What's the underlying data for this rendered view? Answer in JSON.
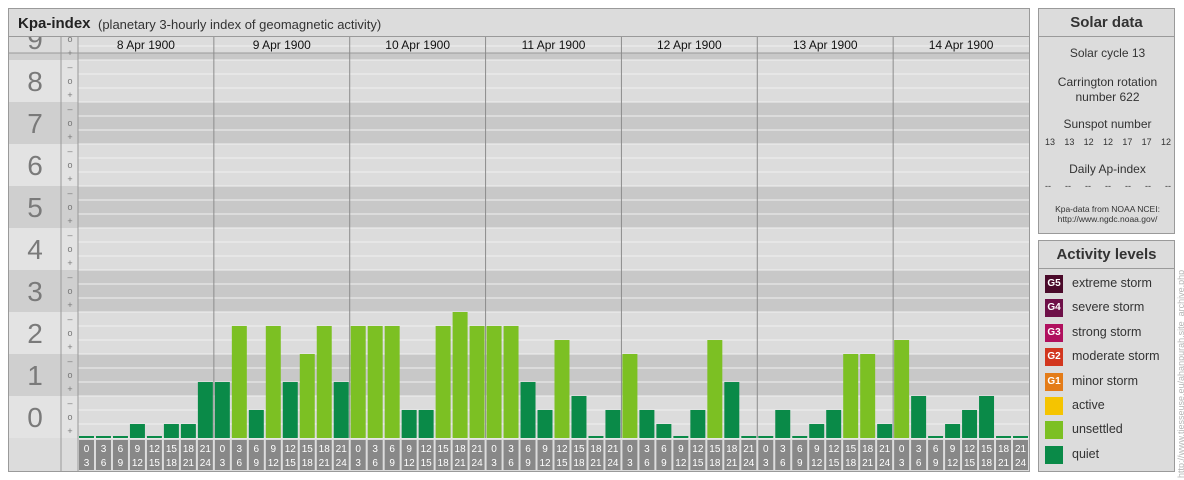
{
  "chart_data": {
    "type": "bar",
    "title": "Kpa-index",
    "subtitle": "(planetary 3-hourly index of geomagnetic activity)",
    "days": [
      "8 Apr 1900",
      "9 Apr 1900",
      "10 Apr 1900",
      "11 Apr 1900",
      "12 Apr 1900",
      "13 Apr 1900",
      "14 Apr 1900"
    ],
    "y_ticks": [
      "0",
      "1",
      "2",
      "3",
      "4",
      "5",
      "6",
      "7",
      "8",
      "9"
    ],
    "y_minor_ticks": [
      "+",
      "o",
      "–"
    ],
    "slot_start": [
      "0",
      "3",
      "6",
      "9",
      "12",
      "15",
      "18",
      "21"
    ],
    "slot_end": [
      "3",
      "6",
      "9",
      "12",
      "15",
      "18",
      "21",
      "24"
    ],
    "ylim": [
      0,
      9.67
    ],
    "values": [
      0,
      0,
      0,
      0.333,
      0,
      0.333,
      0.333,
      1.333,
      1.333,
      2.667,
      0.667,
      2.667,
      1.333,
      2,
      2.667,
      1.333,
      2.667,
      2.667,
      2.667,
      0.667,
      0.667,
      2.667,
      3,
      2.667,
      2.667,
      2.667,
      1.333,
      0.667,
      2.333,
      1,
      0,
      0.667,
      2,
      0.667,
      0.333,
      0,
      0.667,
      2.333,
      1.333,
      0,
      0,
      0.667,
      0,
      0.333,
      0.667,
      2,
      2,
      0.333,
      2.333,
      1,
      0,
      0.333,
      0.667,
      1,
      0,
      0
    ],
    "colors": {
      "quiet": "#0a8a48",
      "unsettled": "#7cc023"
    }
  },
  "solar": {
    "title": "Solar data",
    "cycle": "Solar cycle 13",
    "carrington_1": "Carrington rotation",
    "carrington_2": "number 622",
    "sunspot_title": "Sunspot number",
    "sunspot_values": [
      "13",
      "13",
      "12",
      "12",
      "17",
      "17",
      "12"
    ],
    "ap_title": "Daily Ap-index",
    "ap_values": [
      "--",
      "--",
      "--",
      "--",
      "--",
      "--",
      "--"
    ],
    "source_1": "Kpa-data from NOAA NCEI:",
    "source_2": "http://www.ngdc.noaa.gov/"
  },
  "levels": {
    "title": "Activity levels",
    "items": [
      {
        "badge": "G5",
        "label": "extreme storm",
        "color": "#4a0a2a"
      },
      {
        "badge": "G4",
        "label": "severe storm",
        "color": "#6e1048"
      },
      {
        "badge": "G3",
        "label": "strong storm",
        "color": "#b0105e"
      },
      {
        "badge": "G2",
        "label": "moderate storm",
        "color": "#d2361e"
      },
      {
        "badge": "G1",
        "label": "minor storm",
        "color": "#e47c18"
      },
      {
        "badge": "",
        "label": "active",
        "color": "#f5c400"
      },
      {
        "badge": "",
        "label": "unsettled",
        "color": "#7cc023"
      },
      {
        "badge": "",
        "label": "quiet",
        "color": "#0a8a48"
      }
    ]
  },
  "watermark": "http://www.tiesseuse.eu/ahanpurah.site_archive.php"
}
